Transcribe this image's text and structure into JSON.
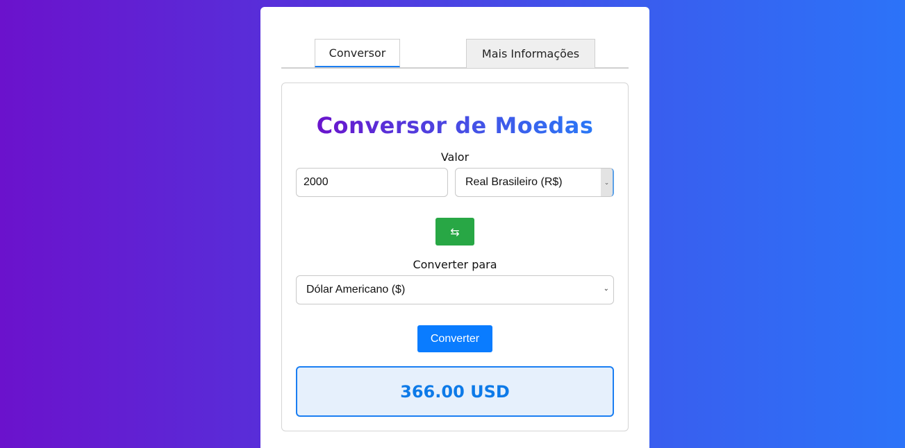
{
  "tabs": {
    "converter_label": "Conversor",
    "info_label": "Mais Informações"
  },
  "converter": {
    "title": "Conversor de Moedas",
    "value_label": "Valor",
    "amount": "2000",
    "from_currency": "Real Brasileiro (R$)",
    "swap_icon": "swap-arrows-icon",
    "swap_glyph": "⇆",
    "to_label": "Converter para",
    "to_currency": "Dólar Americano ($)",
    "convert_label": "Converter",
    "result": "366.00 USD"
  },
  "colors": {
    "accent_blue": "#0a7cff",
    "swap_green": "#28a745",
    "result_bg": "#e6f0fc",
    "gradient_start": "#6b12cc",
    "gradient_end": "#2c73f8"
  }
}
